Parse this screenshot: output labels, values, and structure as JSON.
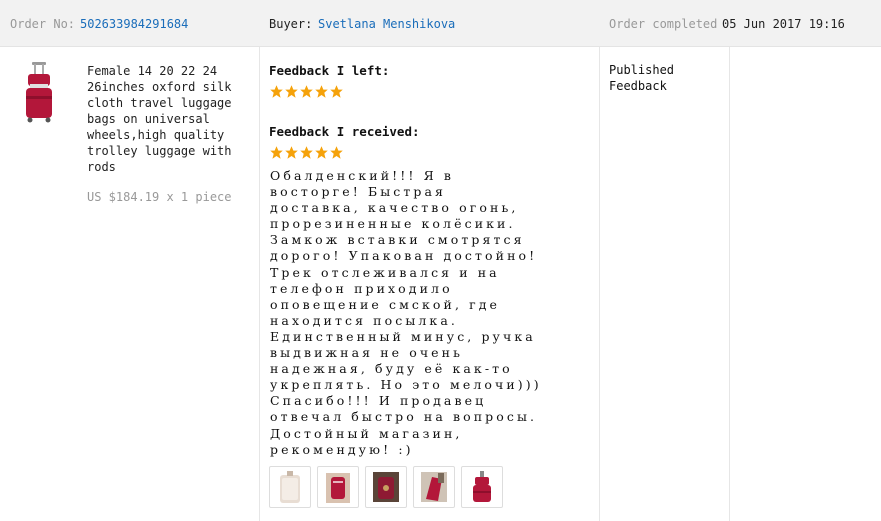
{
  "header": {
    "order_label": "Order No:",
    "order_number": "502633984291684",
    "buyer_label": "Buyer:",
    "buyer_name": "Svetlana Menshikova",
    "completed_label": "Order completed",
    "completed_date": "05 Jun 2017 19:16"
  },
  "product": {
    "title": "Female 14 20 22 24 26inches oxford silk cloth travel luggage bags on universal wheels,high quality trolley luggage with rods",
    "price_line": "US $184.19 x 1 piece",
    "image_icon": "red-trolley-luggage-set"
  },
  "feedback_left": {
    "label": "Feedback I left:",
    "rating": 5,
    "max_rating": 5
  },
  "feedback_received": {
    "label": "Feedback I received:",
    "rating": 5,
    "max_rating": 5,
    "comment": "Обалденский!!! Я в\nвосторге! Быстрая\nдоставка, качество огонь,\nпрорезиненные колёсики.\nЗамкож вставки смотрятся\nдорого! Упакован достойно!\nТрек отслеживался и на\nтелефон приходило\nоповещение смской, где\nнаходится посылка.\nЕдинственный минус, ручка\nвыдвижная не очень\nнадежная, буду её как-то\nукреплять. Но это мелочи)))\nСпасибо!!! И продавец\nотвечал быстро на вопросы.\nДостойный магазин,\nрекомендую! :)",
    "photos": [
      "photo-thumbnail-1",
      "photo-thumbnail-2",
      "photo-thumbnail-3",
      "photo-thumbnail-4",
      "photo-thumbnail-5"
    ]
  },
  "status": {
    "text": "Published\nFeedback"
  },
  "colors": {
    "star": "#f5a20a",
    "link": "#1a6dba",
    "luggage": "#b3173a"
  }
}
